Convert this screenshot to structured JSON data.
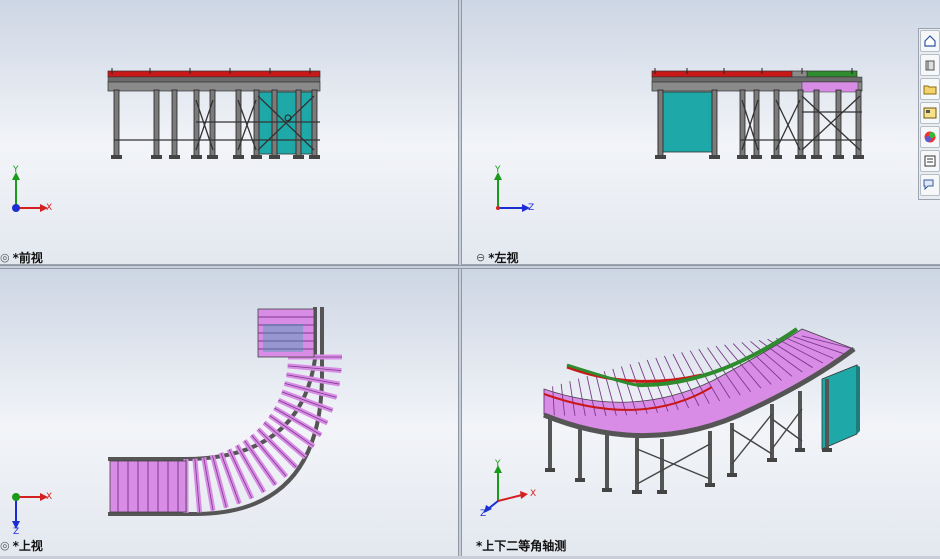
{
  "views": {
    "front": {
      "label": "*前视"
    },
    "left": {
      "label": "*左视"
    },
    "top": {
      "label": "*上视"
    },
    "iso": {
      "label": "*上下二等角轴测"
    }
  },
  "axes": {
    "front": {
      "vertical": "Y",
      "horizontal": "X"
    },
    "left": {
      "vertical": "Y",
      "horizontal": "Z"
    },
    "top": {
      "vertical": "Z",
      "horizontal": "X"
    },
    "iso": {
      "vertical": "Y",
      "horizontal": "X",
      "depth": "Z"
    }
  },
  "taskpane": {
    "icons": [
      "home-icon",
      "parts-3d-icon",
      "folder-icon",
      "view-palette-icon",
      "appearance-icon",
      "properties-icon",
      "forum-icon"
    ]
  },
  "colors": {
    "roller": "#d98ce6",
    "frame": "#5a5a5a",
    "guard_red": "#c81818",
    "guard_green": "#2e8b2e",
    "panel_teal": "#1fa8a8",
    "axis_x": "#d42020",
    "axis_y": "#1a9a1a",
    "axis_z": "#1a2ed4"
  }
}
